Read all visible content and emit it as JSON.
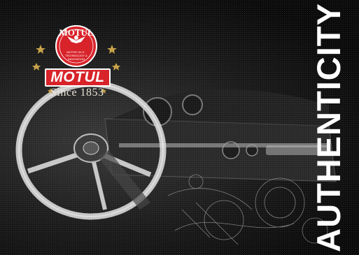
{
  "headline": "AUTHENTICITY",
  "logo": {
    "roundel_brand": "MOTUL",
    "roundel_subtext": "MOTOR OILS · TECHNOLOGY & INNOVATION",
    "plaque_brand": "MOTUL",
    "tagline": "Since 1853"
  },
  "colors": {
    "brand_red": "#d8232a",
    "background": "#0b0b0b",
    "headline": "#ffffff"
  }
}
